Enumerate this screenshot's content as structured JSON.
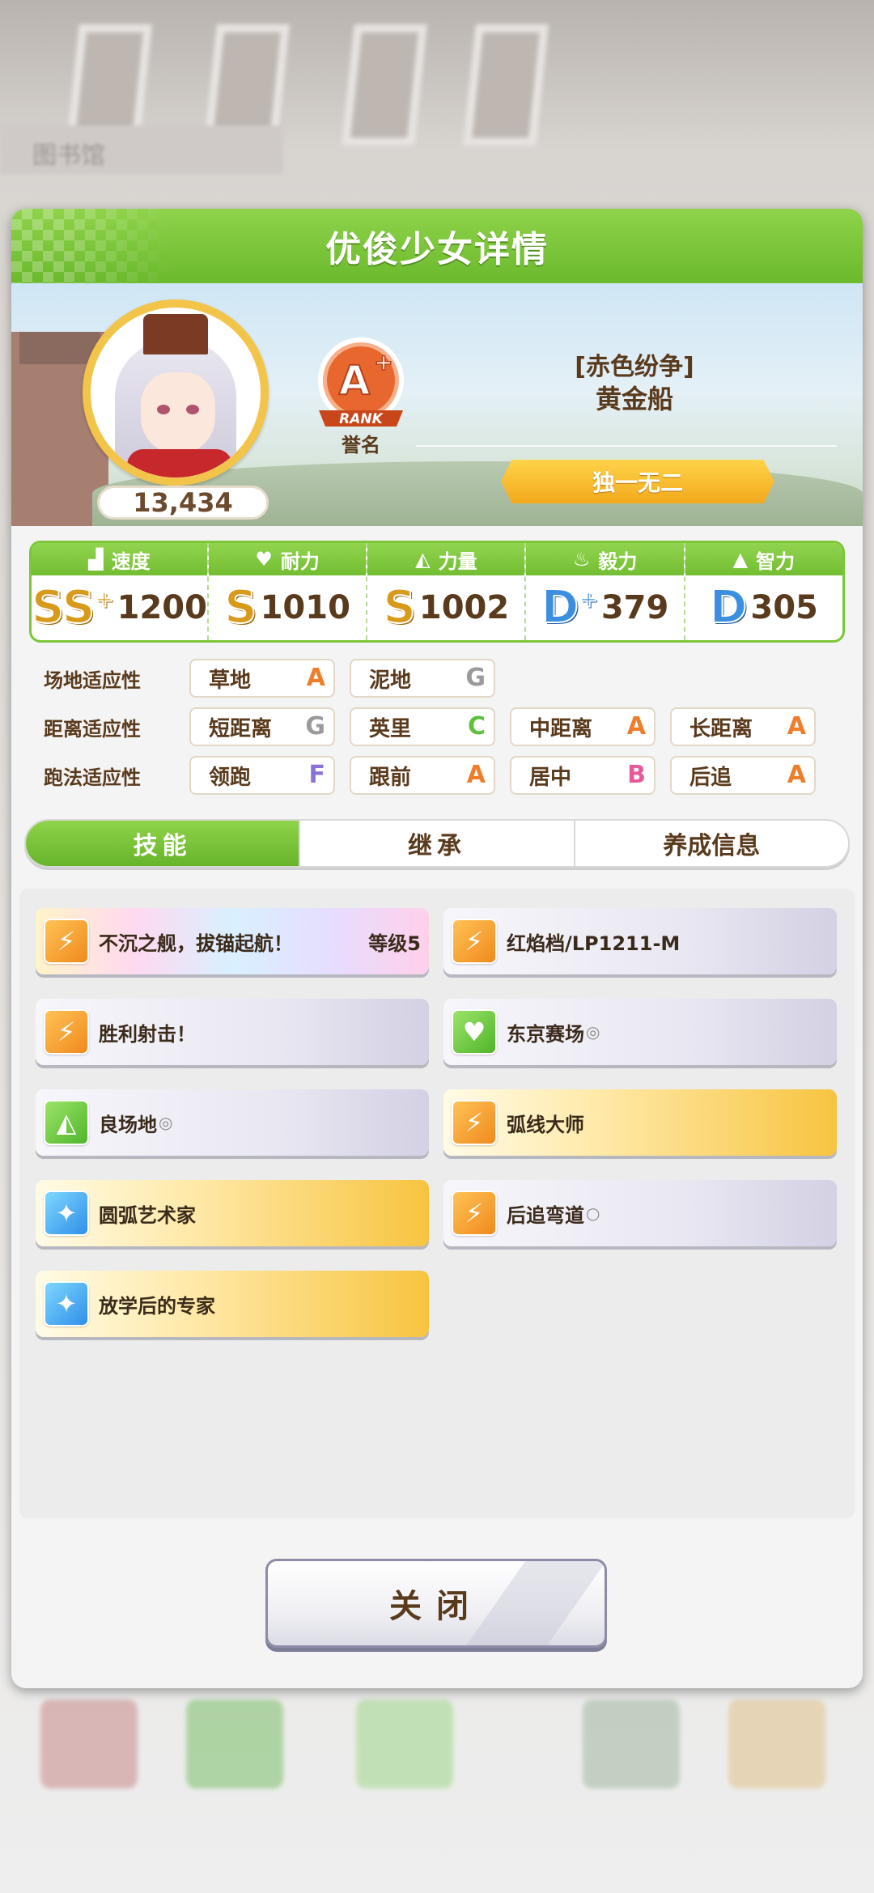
{
  "background": {
    "sign_text": "图书馆"
  },
  "header": {
    "title": "优俊少女详情"
  },
  "profile": {
    "score": "13,434",
    "rank_caption": "誉名",
    "rank_grade": "A+",
    "rank_word": "RANK",
    "epithet": "[赤色纷争]",
    "name": "黄金船",
    "title_ribbon": "独一无二"
  },
  "stats": [
    {
      "label": "速度",
      "icon": "shoe-icon",
      "grade": "SS",
      "plus": "+",
      "value": "1200",
      "grade_color": "gold"
    },
    {
      "label": "耐力",
      "icon": "heart-icon",
      "grade": "S",
      "plus": "",
      "value": "1010",
      "grade_color": "gold"
    },
    {
      "label": "力量",
      "icon": "muscle-icon",
      "grade": "S",
      "plus": "",
      "value": "1002",
      "grade_color": "gold"
    },
    {
      "label": "毅力",
      "icon": "flame-icon",
      "grade": "D",
      "plus": "+",
      "value": "379",
      "grade_color": "blue"
    },
    {
      "label": "智力",
      "icon": "graduation-cap-icon",
      "grade": "D",
      "plus": "",
      "value": "305",
      "grade_color": "blue"
    }
  ],
  "aptitude": {
    "track": {
      "label": "场地适应性",
      "items": [
        {
          "name": "草地",
          "grade": "A"
        },
        {
          "name": "泥地",
          "grade": "G"
        }
      ]
    },
    "distance": {
      "label": "距离适应性",
      "items": [
        {
          "name": "短距离",
          "grade": "G"
        },
        {
          "name": "英里",
          "grade": "C"
        },
        {
          "name": "中距离",
          "grade": "A"
        },
        {
          "name": "长距离",
          "grade": "A"
        }
      ]
    },
    "style": {
      "label": "跑法适应性",
      "items": [
        {
          "name": "领跑",
          "grade": "F"
        },
        {
          "name": "跟前",
          "grade": "A"
        },
        {
          "name": "居中",
          "grade": "B"
        },
        {
          "name": "后追",
          "grade": "A"
        }
      ]
    }
  },
  "tabs": [
    {
      "label": "技能",
      "active": true
    },
    {
      "label": "继承",
      "active": false
    },
    {
      "label": "养成信息",
      "active": false
    }
  ],
  "skills": [
    {
      "name": "不沉之舰，拔锚起航！",
      "level": "等级5",
      "style": "rainbow",
      "icon": "runner-icon",
      "icon_color": "orange",
      "mark": ""
    },
    {
      "name": "红焰档/LP1211-M",
      "level": "",
      "style": "white",
      "icon": "runner-icon",
      "icon_color": "orange",
      "mark": ""
    },
    {
      "name": "胜利射击！",
      "level": "",
      "style": "white",
      "icon": "runner-icon",
      "icon_color": "orange",
      "mark": ""
    },
    {
      "name": "东京赛场",
      "level": "",
      "style": "white",
      "icon": "heart-icon",
      "icon_color": "green",
      "mark": "◎"
    },
    {
      "name": "良场地",
      "level": "",
      "style": "white",
      "icon": "muscle-icon",
      "icon_color": "green",
      "mark": "◎"
    },
    {
      "name": "弧线大师",
      "level": "",
      "style": "gold",
      "icon": "runner-icon",
      "icon_color": "orange",
      "mark": ""
    },
    {
      "name": "圆弧艺术家",
      "level": "",
      "style": "gold",
      "icon": "sparkle-icon",
      "icon_color": "blue",
      "mark": ""
    },
    {
      "name": "后追弯道",
      "level": "",
      "style": "white",
      "icon": "runner-icon",
      "icon_color": "orange",
      "mark": "○"
    },
    {
      "name": "放学后的专家",
      "level": "",
      "style": "gold",
      "icon": "sparkle-icon",
      "icon_color": "blue",
      "mark": ""
    }
  ],
  "close_button": {
    "label": "关闭"
  }
}
